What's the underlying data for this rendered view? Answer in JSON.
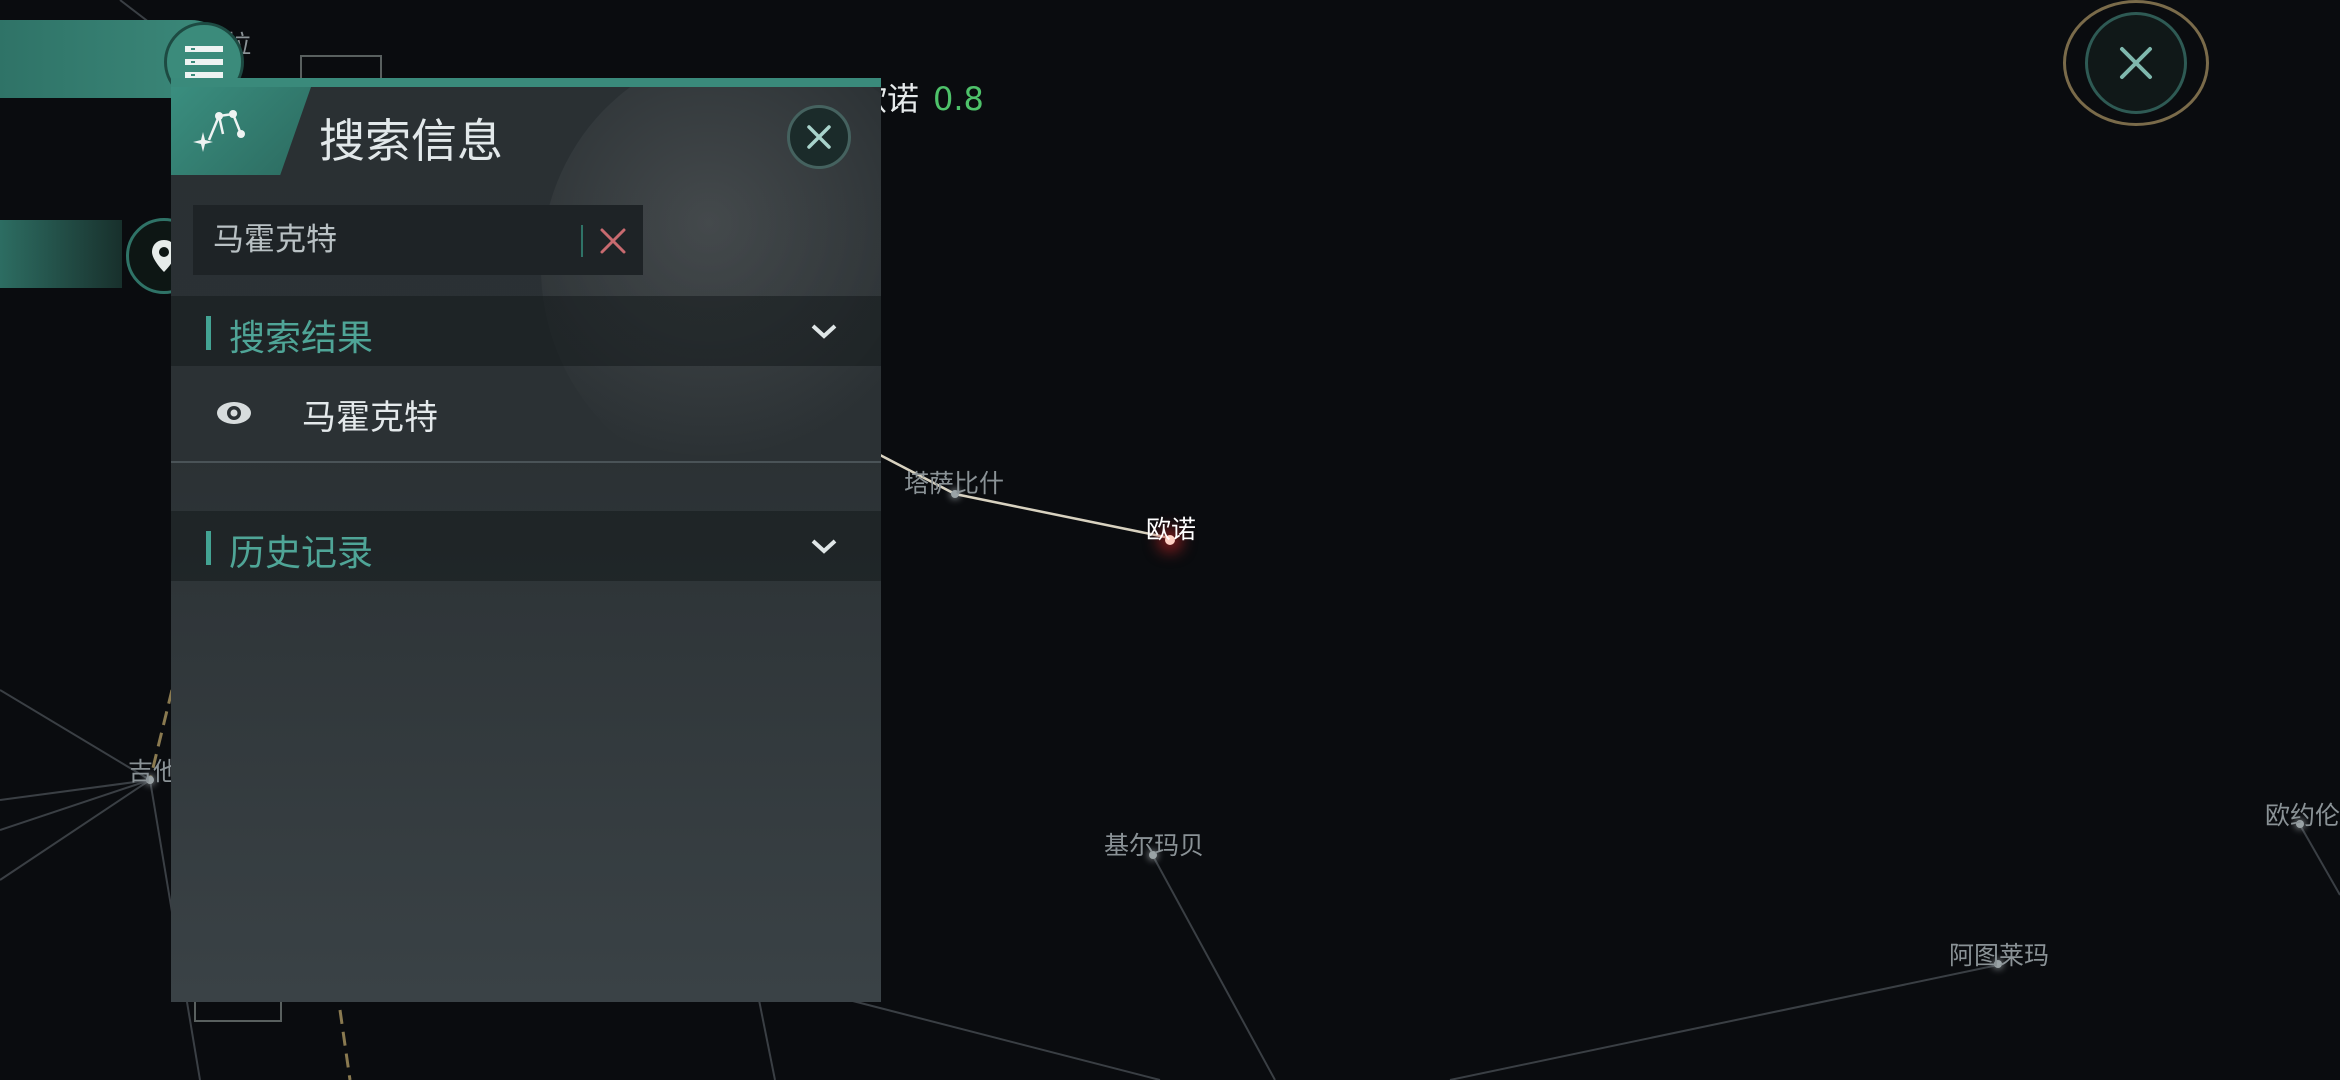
{
  "map": {
    "current_system": "欧诺",
    "systems": [
      {
        "id": "tasabishi",
        "name": "塔萨比什",
        "label": "塔萨比什",
        "current": false
      },
      {
        "id": "ouno",
        "name": "欧诺",
        "label": "欧诺",
        "current": true
      },
      {
        "id": "jierma",
        "name": "基尔玛贝",
        "label": "基尔玛贝",
        "current": false
      },
      {
        "id": "atulaima",
        "name": "阿图莱玛",
        "label": "阿图莱玛",
        "current": false
      },
      {
        "id": "ouyuelun",
        "name": "欧约伦",
        "label": "欧约伦",
        "current": false
      },
      {
        "id": "jita",
        "name": "吉他",
        "label": "吉他",
        "current": false
      },
      {
        "id": "la",
        "name": "拉",
        "label": "拉",
        "current": false
      }
    ]
  },
  "route_header": {
    "system_partial": "欧诺",
    "security": "0.8",
    "security_color": "#4ec26a"
  },
  "panel": {
    "title": "搜索信息",
    "search": {
      "value": "马霍克特",
      "placeholder": ""
    },
    "sections": {
      "results": {
        "label": "搜索结果"
      },
      "history": {
        "label": "历史记录"
      }
    },
    "results": [
      {
        "label": "马霍克特",
        "icon": "planet-eye-icon"
      }
    ]
  },
  "icons": {
    "menu": "menu-list-icon",
    "location": "location-pin-icon",
    "close": "close-icon",
    "constellation": "constellation-icon",
    "chevron": "chevron-down-icon"
  },
  "colors": {
    "accent": "#3a8a7b",
    "accent_text": "#4fa597",
    "panel_bg": "#2a3033",
    "map_bg": "#0a0c0f"
  }
}
